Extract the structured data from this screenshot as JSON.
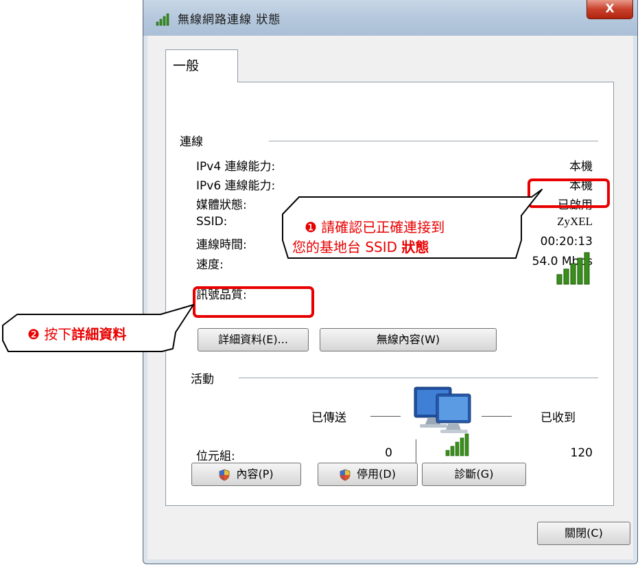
{
  "window": {
    "title": "無線網路連線 狀態",
    "close_label": "X"
  },
  "tabs": [
    {
      "label": "一般"
    }
  ],
  "connection": {
    "section_label": "連線",
    "rows": [
      {
        "label": "IPv4 連線能力:",
        "value": "本機"
      },
      {
        "label": "IPv6 連線能力:",
        "value": "本機"
      },
      {
        "label": "媒體狀態:",
        "value": "已啟用"
      },
      {
        "label": "SSID:",
        "value": "ZyXEL"
      },
      {
        "label": "連線時間:",
        "value": "00:20:13"
      },
      {
        "label": "速度:",
        "value": "54.0 Mbps"
      }
    ],
    "signal_label": "訊號品質:",
    "details_button": "詳細資料(E)...",
    "wireless_props_button": "無線內容(W)"
  },
  "activity": {
    "section_label": "活動",
    "sent_label": "已傳送",
    "received_label": "已收到",
    "bytes_label": "位元組:",
    "bytes_sent": "0",
    "bytes_received": "120"
  },
  "bottom_buttons": {
    "properties": "內容(P)",
    "disable": "停用(D)",
    "diagnose": "診斷(G)"
  },
  "close_button": "關閉(C)",
  "callouts": {
    "ssid_marker": "❶",
    "ssid_line1": "請確認已正確連接到",
    "ssid_line2_prefix": "您的基地台 SSID ",
    "ssid_line2_bold": "狀態",
    "details_marker": "❷",
    "details_prefix": "按下",
    "details_bold": "詳細資料"
  },
  "colors": {
    "highlight_red": "#e80000",
    "signal_green": "#3a8f1c"
  },
  "icons": {
    "title": "wireless-signal-icon",
    "signal": "signal-bars-icon",
    "network": "network-computers-icon",
    "shield": "uac-shield-icon"
  }
}
